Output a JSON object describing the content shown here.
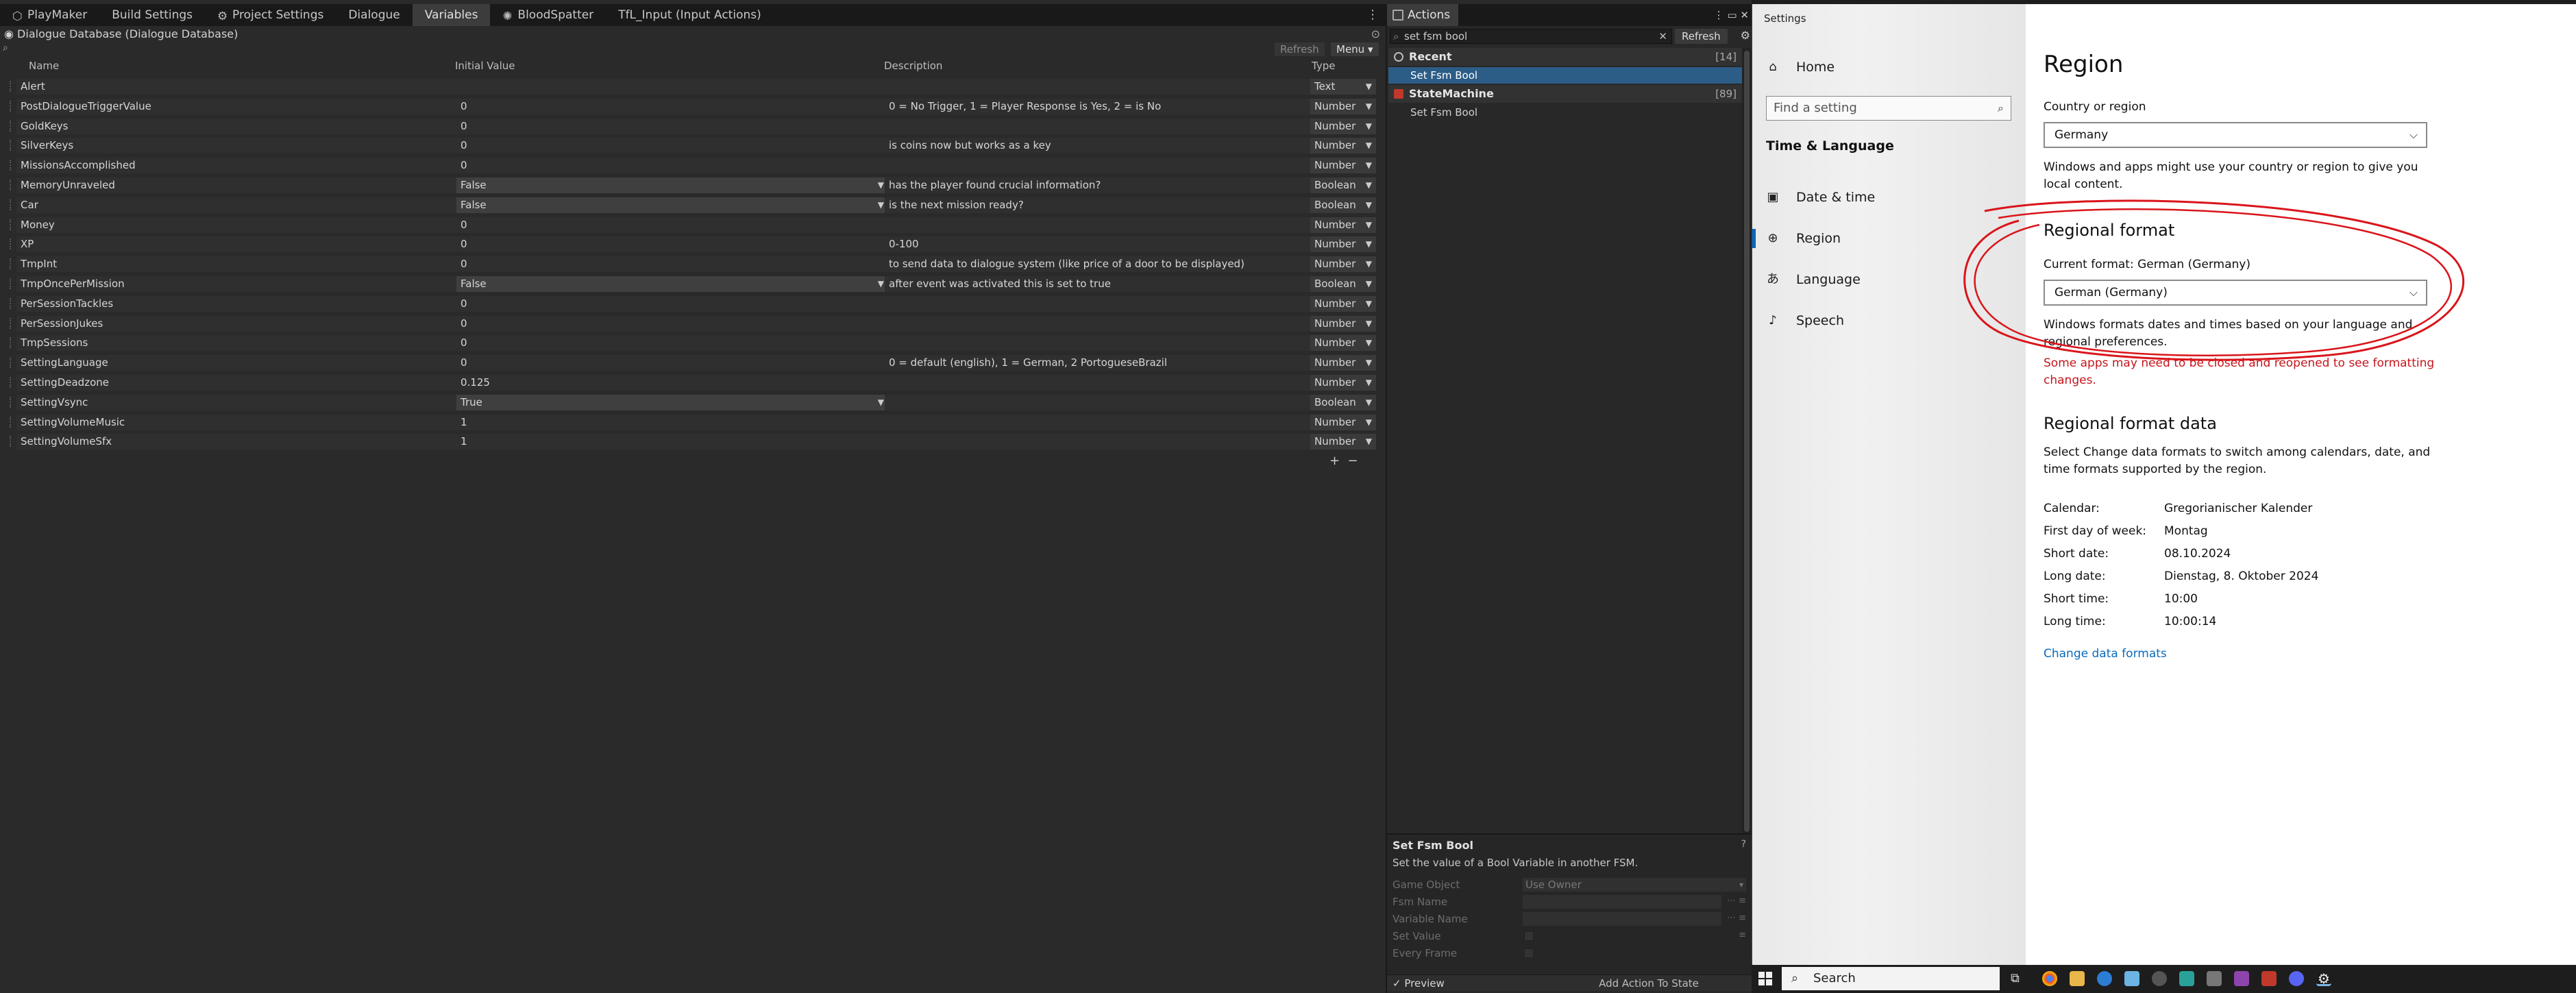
{
  "unity": {
    "tabs": [
      {
        "label": "PlayMaker",
        "icon": "playmaker-icon"
      },
      {
        "label": "Build Settings",
        "icon": ""
      },
      {
        "label": "Project Settings",
        "icon": "gear-icon"
      },
      {
        "label": "Dialogue",
        "icon": ""
      },
      {
        "label": "Variables",
        "icon": ""
      },
      {
        "label": "BloodSpatter",
        "icon": "blood-icon"
      },
      {
        "label": "TfL_Input (Input Actions)",
        "icon": ""
      }
    ],
    "title": "Dialogue Database (Dialogue Database)",
    "toolbar": {
      "refresh": "Refresh",
      "menu": "Menu"
    },
    "columns": {
      "name": "Name",
      "initial": "Initial Value",
      "description": "Description",
      "type": "Type"
    },
    "rows": [
      {
        "name": "Alert",
        "initial": "",
        "desc": "",
        "type": "Text",
        "dropdown": false
      },
      {
        "name": "PostDialogueTriggerValue",
        "initial": "0",
        "desc": "0 = No Trigger, 1 = Player Response is Yes, 2 = is No",
        "type": "Number",
        "dropdown": false
      },
      {
        "name": "GoldKeys",
        "initial": "0",
        "desc": "",
        "type": "Number",
        "dropdown": false
      },
      {
        "name": "SilverKeys",
        "initial": "0",
        "desc": "is coins now but works as a key",
        "type": "Number",
        "dropdown": false
      },
      {
        "name": "MissionsAccomplished",
        "initial": "0",
        "desc": "",
        "type": "Number",
        "dropdown": false
      },
      {
        "name": "MemoryUnraveled",
        "initial": "False",
        "desc": "has the player found crucial information?",
        "type": "Boolean",
        "dropdown": true
      },
      {
        "name": "Car",
        "initial": "False",
        "desc": "is the next mission ready?",
        "type": "Boolean",
        "dropdown": true
      },
      {
        "name": "Money",
        "initial": "0",
        "desc": "",
        "type": "Number",
        "dropdown": false
      },
      {
        "name": "XP",
        "initial": "0",
        "desc": "0-100",
        "type": "Number",
        "dropdown": false
      },
      {
        "name": "TmpInt",
        "initial": "0",
        "desc": "to send data to dialogue system (like price of a door to be displayed)",
        "type": "Number",
        "dropdown": false
      },
      {
        "name": "TmpOncePerMission",
        "initial": "False",
        "desc": "after event was activated this is set to true",
        "type": "Boolean",
        "dropdown": true
      },
      {
        "name": "PerSessionTackles",
        "initial": "0",
        "desc": "",
        "type": "Number",
        "dropdown": false
      },
      {
        "name": "PerSessionJukes",
        "initial": "0",
        "desc": "",
        "type": "Number",
        "dropdown": false
      },
      {
        "name": "TmpSessions",
        "initial": "0",
        "desc": "",
        "type": "Number",
        "dropdown": false
      },
      {
        "name": "SettingLanguage",
        "initial": "0",
        "desc": "0 = default (english), 1 = German, 2 PortogueseBrazil",
        "type": "Number",
        "dropdown": false
      },
      {
        "name": "SettingDeadzone",
        "initial": "0.125",
        "desc": "",
        "type": "Number",
        "dropdown": false
      },
      {
        "name": "SettingVsync",
        "initial": "True",
        "desc": "",
        "type": "Boolean",
        "dropdown": true
      },
      {
        "name": "SettingVolumeMusic",
        "initial": "1",
        "desc": "",
        "type": "Number",
        "dropdown": false
      },
      {
        "name": "SettingVolumeSfx",
        "initial": "1",
        "desc": "",
        "type": "Number",
        "dropdown": false
      }
    ]
  },
  "actions": {
    "tab": "Actions",
    "search_value": "set fsm bool",
    "refresh": "Refresh",
    "categories": [
      {
        "name": "Recent",
        "count": "[14]",
        "items": [
          "Set Fsm Bool"
        ],
        "selected": 0
      },
      {
        "name": "StateMachine",
        "count": "[89]",
        "items": [
          "Set Fsm Bool"
        ],
        "selected": -1
      }
    ],
    "detail": {
      "title": "Set Fsm Bool",
      "description": "Set the value of a Bool Variable in another FSM.",
      "fields": [
        {
          "label": "Game Object",
          "value": "Use Owner"
        },
        {
          "label": "Fsm Name",
          "value": ""
        },
        {
          "label": "Variable Name",
          "value": ""
        },
        {
          "label": "Set Value",
          "value": ""
        },
        {
          "label": "Every Frame",
          "value": ""
        }
      ]
    },
    "preview": "Preview",
    "add_action": "Add Action To State"
  },
  "settings": {
    "app_title": "Settings",
    "nav": {
      "home": "Home",
      "search_placeholder": "Find a setting",
      "section": "Time & Language",
      "items": [
        "Date & time",
        "Region",
        "Language",
        "Speech"
      ],
      "selected": "Region"
    },
    "page_title": "Region",
    "country_label": "Country or region",
    "country_value": "Germany",
    "country_help": "Windows and apps might use your country or region to give you local content.",
    "regional_format_title": "Regional format",
    "current_format": "Current format: German (Germany)",
    "format_value": "German (Germany)",
    "format_help": "Windows formats dates and times based on your language and regional preferences.",
    "warning": "Some apps may need to be closed and reopened to see formatting changes.",
    "data_title": "Regional format data",
    "data_help": "Select Change data formats to switch among calendars, date, and time formats supported by the region.",
    "data": [
      {
        "key": "Calendar:",
        "value": "Gregorianischer Kalender"
      },
      {
        "key": "First day of week:",
        "value": "Montag"
      },
      {
        "key": "Short date:",
        "value": "08.10.2024"
      },
      {
        "key": "Long date:",
        "value": "Dienstag, 8. Oktober 2024"
      },
      {
        "key": "Short time:",
        "value": "10:00"
      },
      {
        "key": "Long time:",
        "value": "10:00:14"
      }
    ],
    "change_link": "Change data formats",
    "annotation_color": "#d9151b"
  },
  "taskbar": {
    "search": "Search"
  }
}
